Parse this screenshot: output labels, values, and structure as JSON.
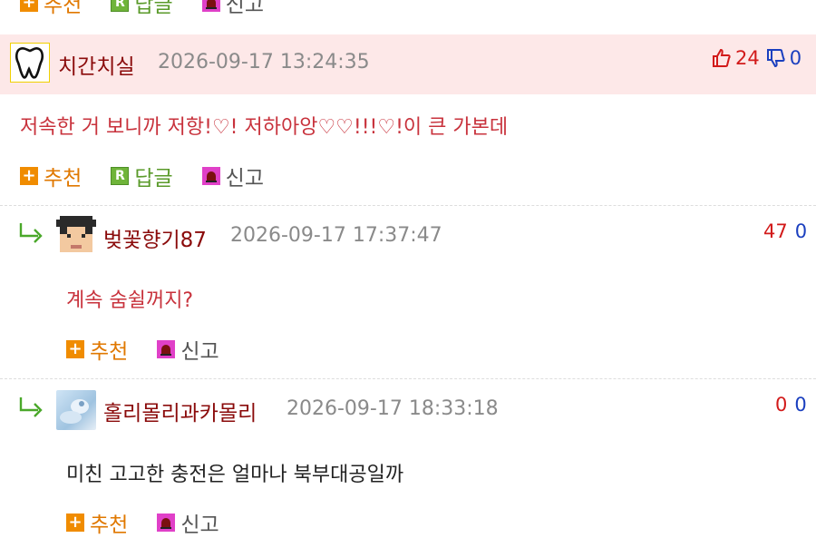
{
  "comments": [
    {
      "nickname": "치간치실",
      "timestamp": "2026-09-17 13:24:35",
      "body": "저속한 거 보니까 저항!♡! 저하아앙♡♡!!!♡!이 큰 가본데",
      "upvotes": "24",
      "downvotes": "0",
      "actions": {
        "recommend": "추천",
        "reply": "답글",
        "report": "신고"
      }
    },
    {
      "nickname": "벚꽃향기87",
      "timestamp": "2026-09-17 17:37:47",
      "body": "계속 숨쉴꺼지?",
      "upvotes": "47",
      "downvotes": "0",
      "actions": {
        "recommend": "추천",
        "report": "신고"
      }
    },
    {
      "nickname": "홀리몰리과카몰리",
      "timestamp": "2026-09-17 18:33:18",
      "body": "미친 고고한 충전은 얼마나 북부대공일까",
      "upvotes": "0",
      "downvotes": "0",
      "actions": {
        "recommend": "추천",
        "report": "신고"
      }
    }
  ],
  "top_actions": {
    "recommend": "추천",
    "reply": "답글",
    "report": "신고"
  },
  "colors": {
    "highlight_bg": "#fde8e8",
    "nickname": "#8a0a0a",
    "body_red": "#c8323c",
    "body_dark": "#222222",
    "upvote": "#d21a1a",
    "downvote": "#1a3fbf"
  },
  "icons": {
    "recommend": "plus-icon",
    "reply": "reply-r-icon",
    "report": "siren-icon",
    "like": "thumbs-up-icon",
    "dislike": "thumbs-down-icon",
    "reply_indent": "reply-arrow-icon",
    "avatar_first": "tooth-icon"
  }
}
